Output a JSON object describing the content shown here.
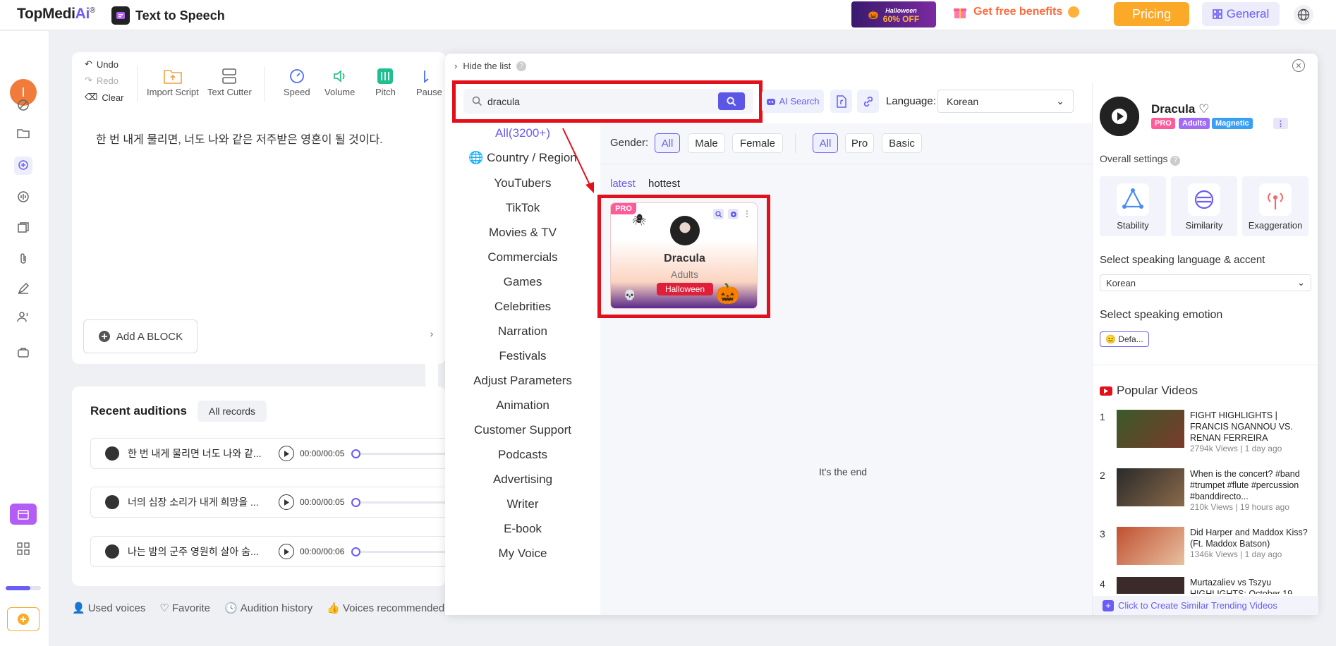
{
  "brand": {
    "name_part1": "TopMedi",
    "name_part2": "Ai",
    "reg": "®"
  },
  "product": {
    "title": "Text to Speech"
  },
  "promo": {
    "top": "Halloween",
    "offer": "60% OFF"
  },
  "header": {
    "benefits": "Get free benefits",
    "pricing": "Pricing",
    "general": "General"
  },
  "user": {
    "initial": "I"
  },
  "toolbar": {
    "undo": "Undo",
    "redo": "Redo",
    "clear": "Clear",
    "import_script": "Import Script",
    "text_cutter": "Text Cutter",
    "speed": "Speed",
    "volume": "Volume",
    "pitch": "Pitch",
    "pause": "Pause"
  },
  "editor": {
    "text": "한 번 내게 물리면, 너도 나와 같은 저주받은 영혼이 될 것이다.",
    "add_block": "Add A BLOCK"
  },
  "recent": {
    "title": "Recent auditions",
    "all_records": "All records",
    "rows": [
      {
        "text": "한 번 내게 물리면 너도 나와 같...",
        "time": "00:00/00:05"
      },
      {
        "text": "너의 심장 소리가 내게 희망을 ...",
        "time": "00:00/00:05"
      },
      {
        "text": "나는 밤의 군주 영원히 살아 숨...",
        "time": "00:00/00:06"
      }
    ]
  },
  "bottom_links": {
    "used": "Used voices",
    "favorite": "Favorite",
    "history": "Audition history",
    "recommended": "Voices recommended"
  },
  "modal": {
    "hide_list": "Hide the list",
    "search_value": "dracula",
    "ai_search": "AI Search",
    "language_label": "Language:",
    "language_value": "Korean",
    "categories": [
      "All(3200+)",
      "Country / Region",
      "YouTubers",
      "TikTok",
      "Movies & TV",
      "Commercials",
      "Games",
      "Celebrities",
      "Narration",
      "Festivals",
      "Adjust Parameters",
      "Animation",
      "Customer Support",
      "Podcasts",
      "Advertising",
      "Writer",
      "E-book",
      "My Voice"
    ],
    "gender_label": "Gender:",
    "gender_filters": [
      "All",
      "Male",
      "Female"
    ],
    "tier_filters": [
      "All",
      "Pro",
      "Basic"
    ],
    "sort_latest": "latest",
    "sort_hottest": "hottest",
    "end_text": "It's the end"
  },
  "voice_card": {
    "badge": "PRO",
    "name": "Dracula",
    "age": "Adults",
    "tag": "Halloween"
  },
  "right_panel": {
    "name": "Dracula",
    "badges": [
      "PRO",
      "Adults",
      "Magnetic"
    ],
    "overall": "Overall settings",
    "settings": [
      "Stability",
      "Similarity",
      "Exaggeration"
    ],
    "lang_label": "Select speaking language & accent",
    "lang_value": "Korean",
    "emotion_label": "Select speaking emotion",
    "emotion_value": "Defa...",
    "popular": "Popular Videos",
    "videos": [
      {
        "num": "1",
        "title": "FIGHT HIGHLIGHTS | FRANCIS NGANNOU VS. RENAN FERREIRA",
        "meta": "2794k Views | 1 day ago"
      },
      {
        "num": "2",
        "title": "When is the concert? #band #trumpet #flute #percussion #banddirecto...",
        "meta": "210k Views | 19 hours ago"
      },
      {
        "num": "3",
        "title": "Did Harper and Maddox Kiss? (Ft. Maddox Batson)",
        "meta": "1346k Views | 1 day ago"
      },
      {
        "num": "4",
        "title": "Murtazaliev vs Tszyu HIGHLIGHTS: October 19",
        "meta": ""
      }
    ],
    "create": "Click to Create Similar Trending Videos"
  },
  "colors": {
    "accent": "#6a5cf6",
    "pricing": "#fba928",
    "highlight": "#e3101b"
  }
}
